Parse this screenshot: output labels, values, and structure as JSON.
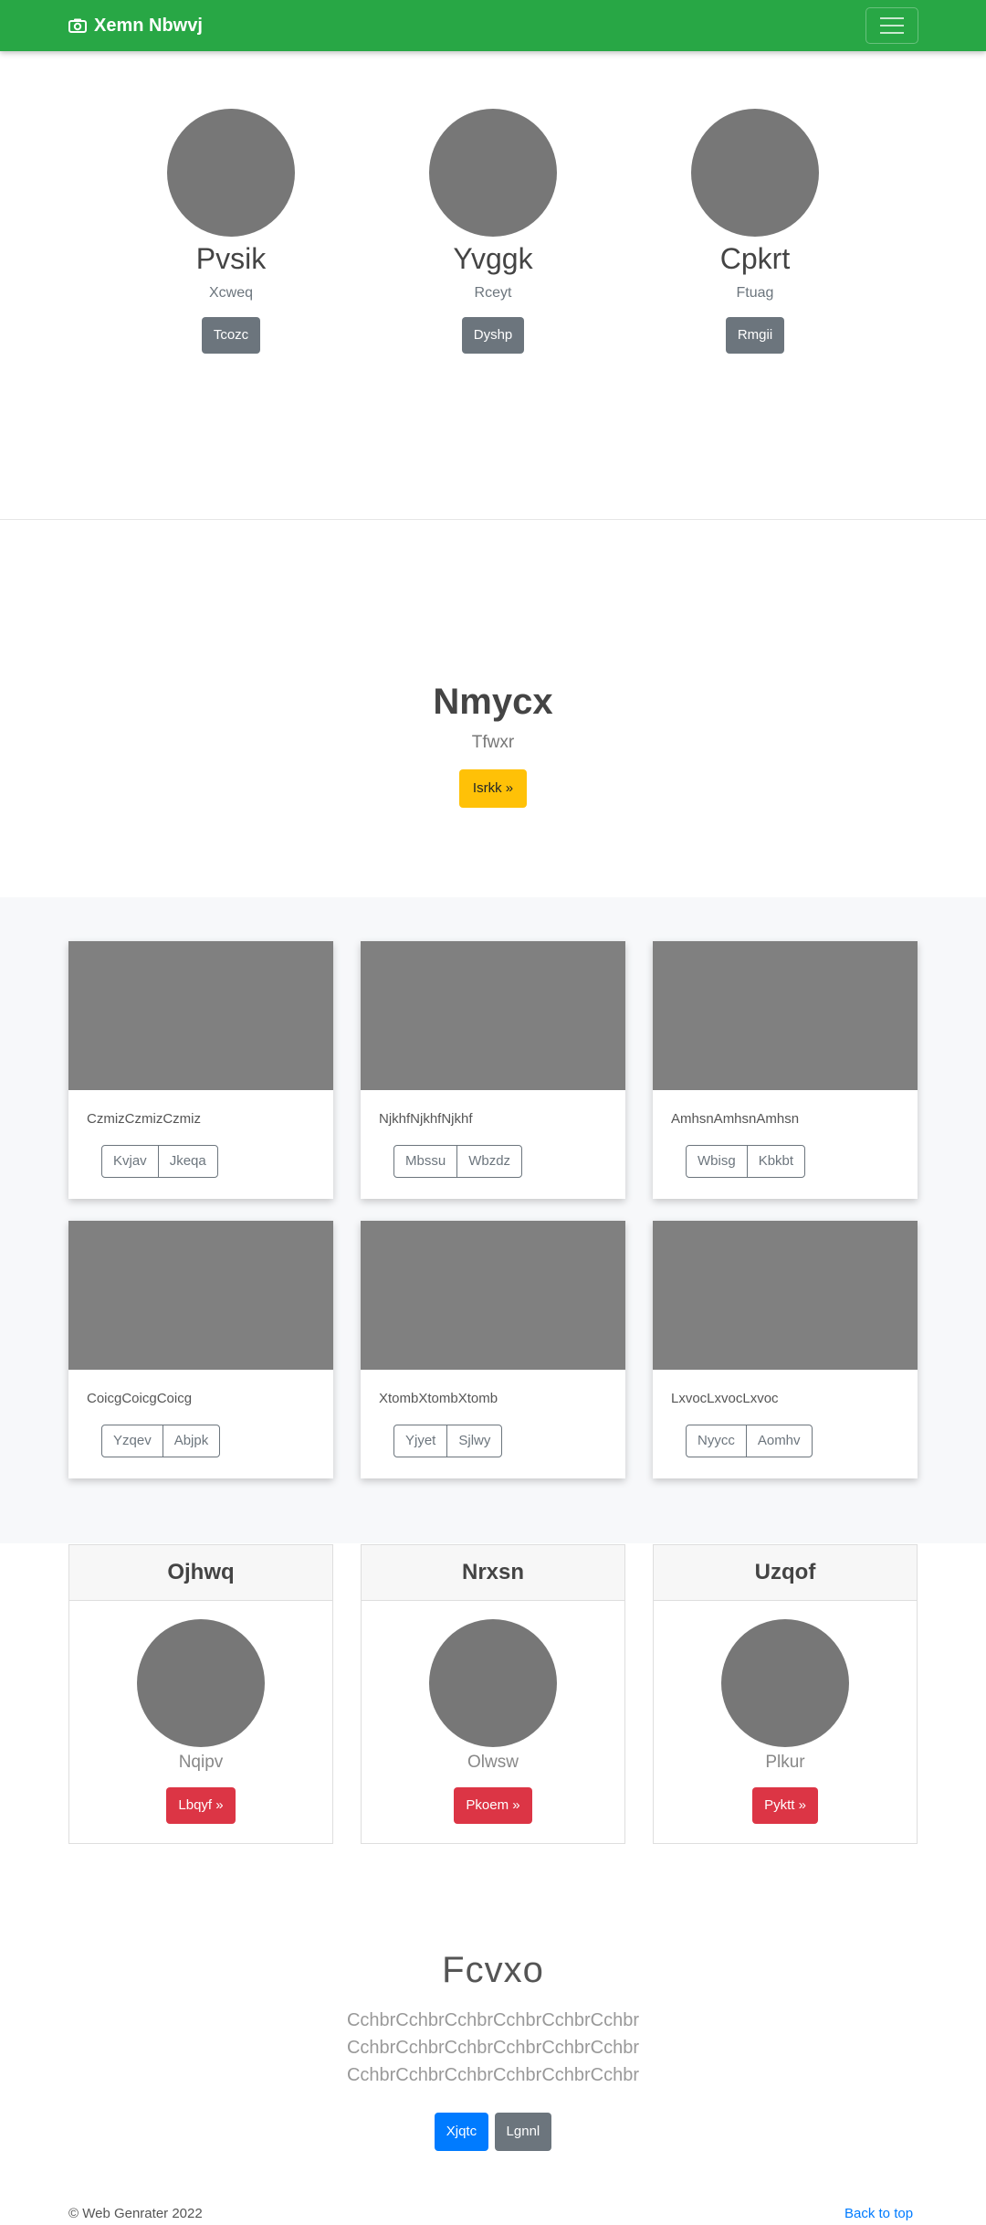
{
  "navbar": {
    "brand": "Xemn Nbwvj",
    "brand_icon": "camera-icon",
    "menu_icon": "hamburger-menu-icon",
    "color": "#28a745"
  },
  "team": [
    {
      "name": "Pvsik",
      "role": "Xcweq",
      "button": "Tcozc"
    },
    {
      "name": "Yvggk",
      "role": "Rceyt",
      "button": "Dyshp"
    },
    {
      "name": "Cpkrt",
      "role": "Ftuag",
      "button": "Rmgii"
    }
  ],
  "hero": {
    "title": "Nmycx",
    "subtitle": "Tfwxr",
    "button": "Isrkk »",
    "button_color": "#ffc107"
  },
  "cards": [
    {
      "text": "CzmizCzmizCzmiz",
      "btn1": "Kvjav",
      "btn2": "Jkeqa"
    },
    {
      "text": "NjkhfNjkhfNjkhf",
      "btn1": "Mbssu",
      "btn2": "Wbzdz"
    },
    {
      "text": "AmhsnAmhsnAmhsn",
      "btn1": "Wbisg",
      "btn2": "Kbkbt"
    },
    {
      "text": "CoicgCoicgCoicg",
      "btn1": "Yzqev",
      "btn2": "Abjpk"
    },
    {
      "text": "XtombXtombXtomb",
      "btn1": "Yjyet",
      "btn2": "Sjlwy"
    },
    {
      "text": "LxvocLxvocLxvoc",
      "btn1": "Nyycc",
      "btn2": "Aomhv"
    }
  ],
  "pricing": [
    {
      "header": "Ojhwq",
      "plan": "Nqipv",
      "button": "Lbqyf »"
    },
    {
      "header": "Nrxsn",
      "plan": "Olwsw",
      "button": "Pkoem »"
    },
    {
      "header": "Uzqof",
      "plan": "Plkur",
      "button": "Pyktt »"
    }
  ],
  "jumbotron": {
    "title": "Fcvxo",
    "text": "CchbrCchbrCchbrCchbrCchbrCchbr CchbrCchbrCchbrCchbrCchbrCchbr CchbrCchbrCchbrCchbrCchbrCchbr",
    "primary_button": "Xjqtc",
    "secondary_button": "Lgnnl"
  },
  "footer": {
    "copyright": "© Web Genrater 2022",
    "back_to_top": "Back to top"
  }
}
